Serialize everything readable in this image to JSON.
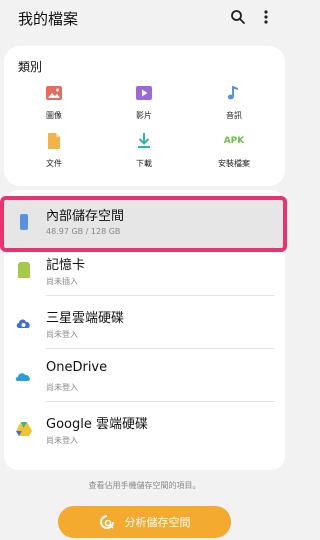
{
  "header": {
    "title": "我的檔案",
    "search_icon": "search-icon",
    "more_icon": "more-vertical-icon"
  },
  "categories": {
    "title": "類別",
    "items": [
      {
        "label": "圖像",
        "icon": "image-icon",
        "color": "#e86b5f"
      },
      {
        "label": "影片",
        "icon": "video-icon",
        "color": "#9b6bd3"
      },
      {
        "label": "音訊",
        "icon": "music-icon",
        "color": "#5b8fe0"
      },
      {
        "label": "文件",
        "icon": "document-icon",
        "color": "#f2b44a"
      },
      {
        "label": "下載",
        "icon": "download-icon",
        "color": "#2fb6a3"
      },
      {
        "label": "安裝檔案",
        "icon": "apk-icon",
        "icon_text": "APK",
        "color": "#6cc04a"
      }
    ]
  },
  "storage": {
    "items": [
      {
        "name": "內部儲存空間",
        "sub": "48.97 GB / 128 GB",
        "icon": "phone-icon",
        "color": "#5b8fe0"
      },
      {
        "name": "記憶卡",
        "sub": "尚未插入",
        "icon": "sd-card-icon",
        "color": "#a6c94a"
      },
      {
        "name": "三星雲端硬碟",
        "sub": "尚未登入",
        "icon": "samsung-cloud-icon",
        "color": "#3e6fd8"
      },
      {
        "name": "OneDrive",
        "sub": "尚未登入",
        "icon": "onedrive-icon",
        "color": "#2c9fd6"
      },
      {
        "name": "Google 雲端硬碟",
        "sub": "尚未登入",
        "icon": "google-drive-icon",
        "color": "#f2c331"
      }
    ]
  },
  "footer": {
    "note": "查看佔用手機儲存空間的項目。",
    "button_label": "分析儲存空間",
    "button_icon": "analyze-storage-icon",
    "button_color": "#f4a92f",
    "highlight_color": "#e8336f"
  }
}
